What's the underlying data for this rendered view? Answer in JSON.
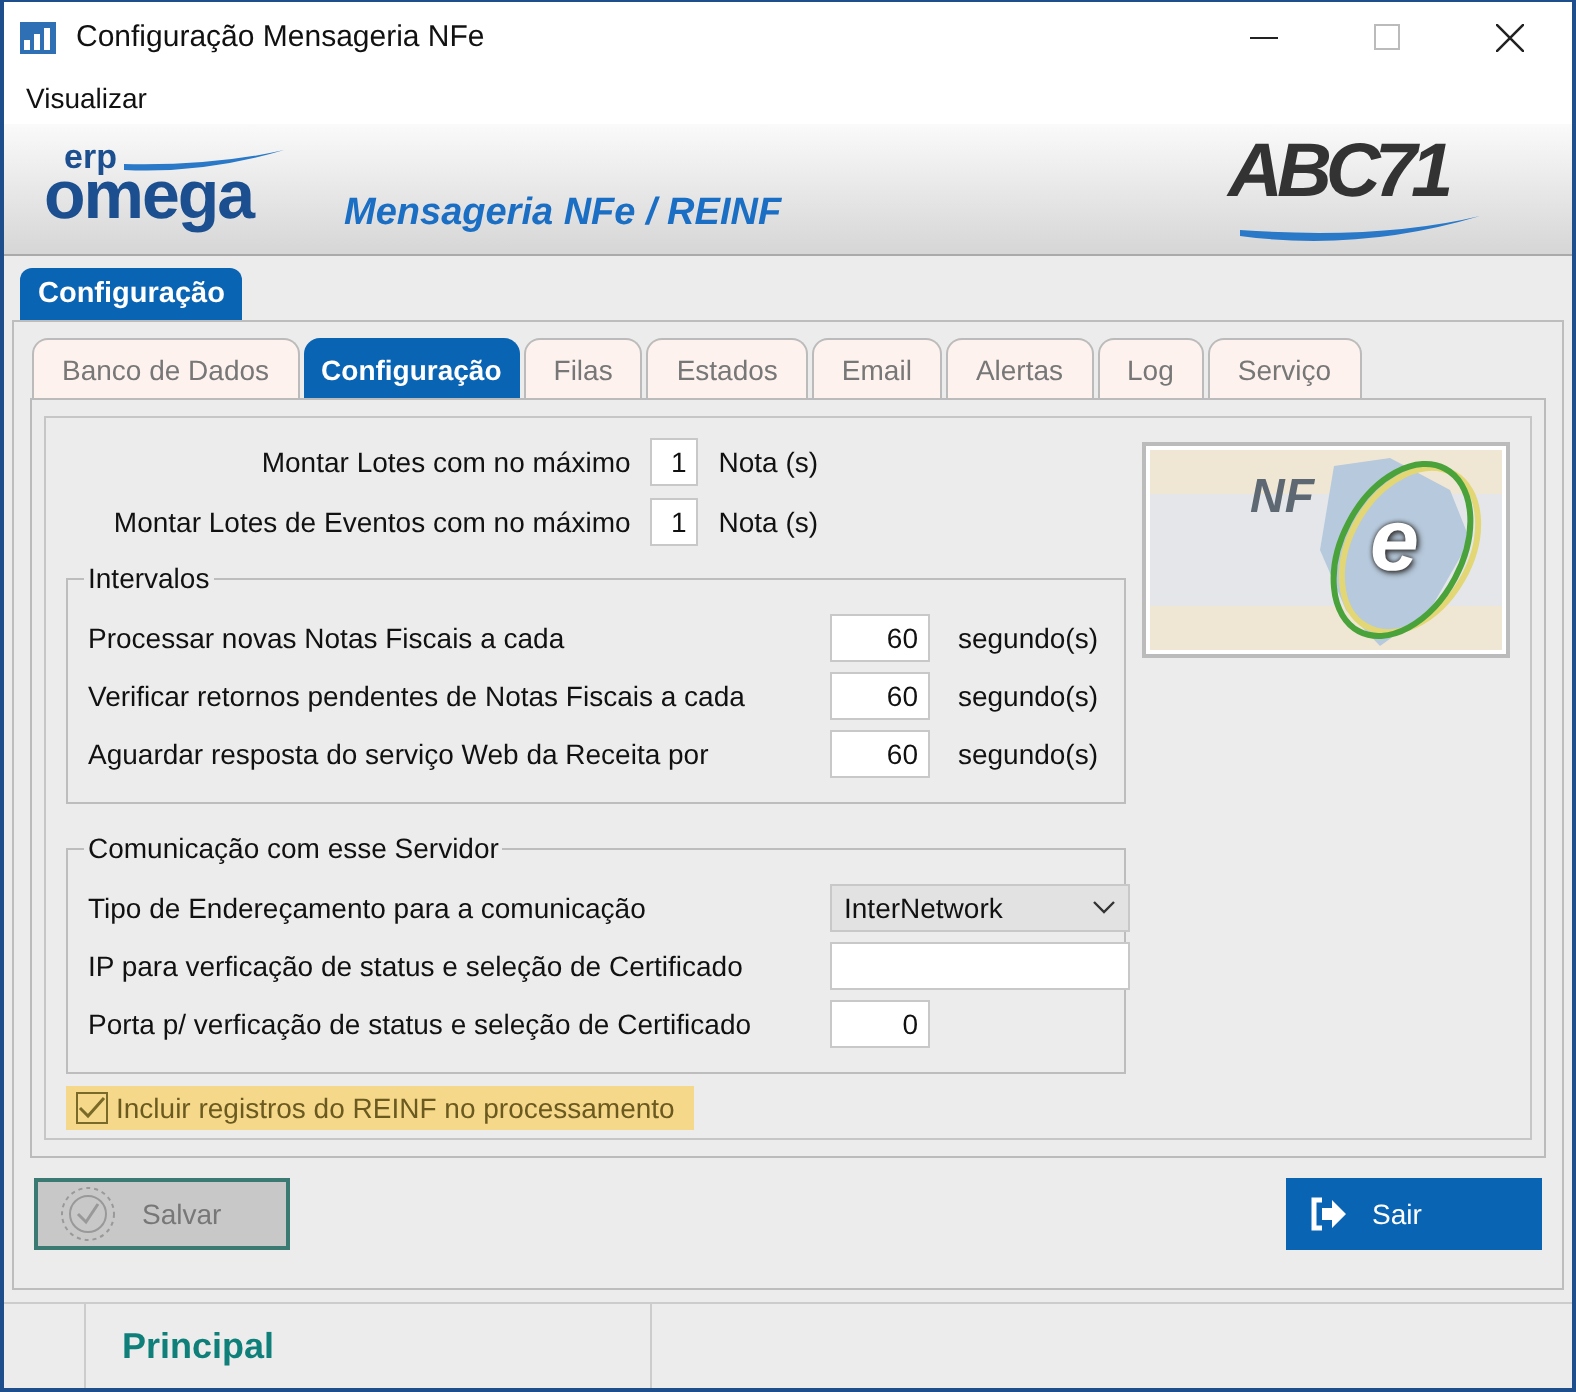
{
  "window": {
    "title": "Configuração Mensageria NFe"
  },
  "menu": [
    {
      "label": "Visualizar"
    }
  ],
  "header": {
    "brand_small": "erp",
    "brand": "omega",
    "subtitle": "Mensageria NFe / REINF",
    "partner_logo": "ABC71"
  },
  "outer_tabs": [
    {
      "label": "Configuração",
      "selected": true
    }
  ],
  "tabs": [
    {
      "label": "Banco de Dados",
      "selected": false
    },
    {
      "label": "Configuração",
      "selected": true
    },
    {
      "label": "Filas",
      "selected": false
    },
    {
      "label": "Estados",
      "selected": false
    },
    {
      "label": "Email",
      "selected": false
    },
    {
      "label": "Alertas",
      "selected": false
    },
    {
      "label": "Log",
      "selected": false
    },
    {
      "label": "Serviço",
      "selected": false
    }
  ],
  "batch": [
    {
      "label": "Montar Lotes com no máximo",
      "value": "1",
      "unit": "Nota (s)"
    },
    {
      "label": "Montar Lotes de Eventos com no máximo",
      "value": "1",
      "unit": "Nota (s)"
    }
  ],
  "nfe_logo": {
    "text": "NF",
    "letter": "e"
  },
  "intervals": {
    "title": "Intervalos",
    "rows": [
      {
        "label": "Processar novas Notas Fiscais a cada",
        "value": "60",
        "unit": "segundo(s)"
      },
      {
        "label": "Verificar retornos pendentes de Notas Fiscais a cada",
        "value": "60",
        "unit": "segundo(s)"
      },
      {
        "label": "Aguardar resposta do serviço Web da Receita por",
        "value": "60",
        "unit": "segundo(s)"
      }
    ]
  },
  "communication": {
    "title": "Comunicação com esse Servidor",
    "rows": [
      {
        "kind": "select",
        "label": "Tipo de Endereçamento para a comunicação",
        "value": "InterNetwork"
      },
      {
        "kind": "text",
        "label": "IP para verficação de status e seleção de Certificado"
      },
      {
        "kind": "number",
        "label": "Porta p/ verficação de status e seleção de Certificado",
        "value": "0"
      }
    ]
  },
  "reinf_option": {
    "label": "Incluir registros do REINF no processamento",
    "checked": true
  },
  "buttons": [
    {
      "kind": "save",
      "label": "Salvar",
      "disabled": true
    },
    {
      "kind": "exit",
      "label": "Sair",
      "disabled": false
    }
  ],
  "status_bar": {
    "label": "Principal"
  }
}
